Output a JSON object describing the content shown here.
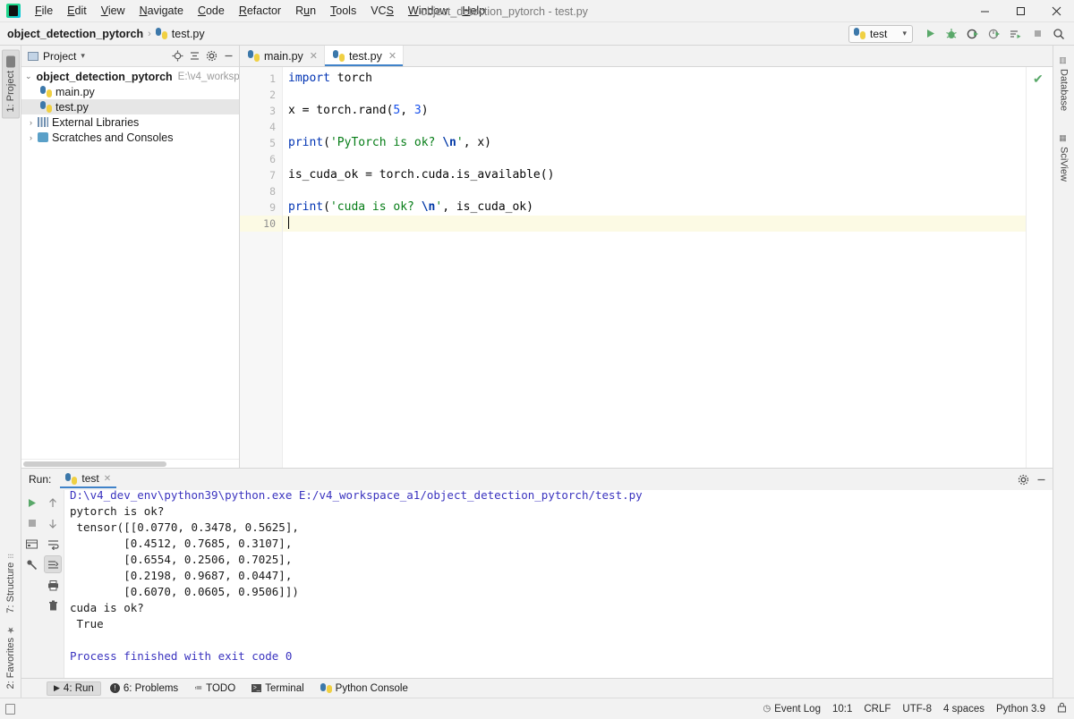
{
  "window": {
    "title": "object_detection_pytorch - test.py",
    "controls": {
      "minimize": "—",
      "maximize": "▢",
      "close": "✕"
    }
  },
  "menu": [
    {
      "label": "File"
    },
    {
      "label": "Edit"
    },
    {
      "label": "View"
    },
    {
      "label": "Navigate"
    },
    {
      "label": "Code"
    },
    {
      "label": "Refactor"
    },
    {
      "label": "Run"
    },
    {
      "label": "Tools"
    },
    {
      "label": "VCS"
    },
    {
      "label": "Window"
    },
    {
      "label": "Help"
    }
  ],
  "navbar": {
    "crumbs": [
      {
        "label": "object_detection_pytorch"
      },
      {
        "label": "test.py"
      }
    ],
    "separator": "›",
    "run_config": {
      "name": "test",
      "chevron": "▾"
    },
    "buttons": [
      {
        "name": "run-button",
        "title": "Run"
      },
      {
        "name": "debug-button",
        "title": "Debug"
      },
      {
        "name": "run-coverage-button",
        "title": "Run with Coverage"
      },
      {
        "name": "profile-button",
        "title": "Profile"
      },
      {
        "name": "run-tests-button",
        "title": "Run tests"
      },
      {
        "name": "stop-button",
        "title": "Stop"
      },
      {
        "name": "search-everywhere-button",
        "title": "Search Everywhere"
      }
    ]
  },
  "left_strip": {
    "top": [
      {
        "label": "1: Project",
        "active": true
      }
    ],
    "bottom": [
      {
        "label": "7: Structure",
        "active": false
      },
      {
        "label": "2: Favorites",
        "active": false
      }
    ]
  },
  "right_strip": [
    {
      "label": "Database"
    },
    {
      "label": "SciView"
    }
  ],
  "project_panel": {
    "title": "Project",
    "chevron": "▾",
    "header_icons": [
      "locate-icon",
      "collapse-all-icon",
      "settings-icon",
      "hide-icon"
    ],
    "tree": [
      {
        "indent": 0,
        "arrow": "⌄",
        "icon": "folder",
        "label": "object_detection_pytorch",
        "bold": true,
        "path": "E:\\v4_worksp",
        "selected": false
      },
      {
        "indent": 1,
        "arrow": "",
        "icon": "python",
        "label": "main.py",
        "bold": false,
        "path": "",
        "selected": false
      },
      {
        "indent": 1,
        "arrow": "",
        "icon": "python",
        "label": "test.py",
        "bold": false,
        "path": "",
        "selected": true
      },
      {
        "indent": 0,
        "arrow": "›",
        "icon": "library",
        "label": "External Libraries",
        "bold": false,
        "path": "",
        "selected": false
      },
      {
        "indent": 0,
        "arrow": "›",
        "icon": "scratch",
        "label": "Scratches and Consoles",
        "bold": false,
        "path": "",
        "selected": false
      }
    ]
  },
  "editor": {
    "tabs": [
      {
        "label": "main.py",
        "active": false,
        "close": "✕"
      },
      {
        "label": "test.py",
        "active": true,
        "close": "✕"
      }
    ],
    "line_numbers": [
      "1",
      "2",
      "3",
      "4",
      "5",
      "6",
      "7",
      "8",
      "9",
      "10"
    ],
    "current_line": 10,
    "inspection_status": "✔",
    "lines": [
      {
        "n": 1,
        "tokens": [
          {
            "t": "kw",
            "v": "import"
          },
          {
            "t": "txt",
            "v": " torch"
          }
        ]
      },
      {
        "n": 2,
        "tokens": []
      },
      {
        "n": 3,
        "tokens": [
          {
            "t": "txt",
            "v": "x = torch.rand("
          },
          {
            "t": "num",
            "v": "5"
          },
          {
            "t": "txt",
            "v": ", "
          },
          {
            "t": "num",
            "v": "3"
          },
          {
            "t": "txt",
            "v": ")"
          }
        ]
      },
      {
        "n": 4,
        "tokens": []
      },
      {
        "n": 5,
        "tokens": [
          {
            "t": "kw",
            "v": "print"
          },
          {
            "t": "txt",
            "v": "("
          },
          {
            "t": "str",
            "v": "'PyTorch is ok? "
          },
          {
            "t": "esc",
            "v": "\\n"
          },
          {
            "t": "str",
            "v": "'"
          },
          {
            "t": "txt",
            "v": ", x)"
          }
        ]
      },
      {
        "n": 6,
        "tokens": []
      },
      {
        "n": 7,
        "tokens": [
          {
            "t": "txt",
            "v": "is_cuda_ok = torch.cuda.is_available()"
          }
        ]
      },
      {
        "n": 8,
        "tokens": []
      },
      {
        "n": 9,
        "tokens": [
          {
            "t": "kw",
            "v": "print"
          },
          {
            "t": "txt",
            "v": "("
          },
          {
            "t": "str",
            "v": "'cuda is ok? "
          },
          {
            "t": "esc",
            "v": "\\n"
          },
          {
            "t": "str",
            "v": "'"
          },
          {
            "t": "txt",
            "v": ", is_cuda_ok)"
          }
        ]
      },
      {
        "n": 10,
        "tokens": []
      }
    ]
  },
  "run_panel": {
    "label": "Run:",
    "tab": {
      "label": "test",
      "close": "✕"
    },
    "header_icons": [
      "settings-icon",
      "hide-icon"
    ],
    "tools_left": [
      "rerun-icon",
      "stop-icon",
      "console-icon",
      "pin-icon"
    ],
    "tools_right": [
      "up-icon",
      "down-icon",
      "soft-wrap-icon",
      "scroll-to-end-icon",
      "print-icon",
      "trash-icon"
    ],
    "output": [
      {
        "cls": "cmd",
        "text": "D:\\v4_dev_env\\python39\\python.exe E:/v4_workspace_a1/object_detection_pytorch/test.py"
      },
      {
        "cls": "",
        "text": "pytorch is ok?"
      },
      {
        "cls": "",
        "text": " tensor([[0.0770, 0.3478, 0.5625],"
      },
      {
        "cls": "",
        "text": "        [0.4512, 0.7685, 0.3107],"
      },
      {
        "cls": "",
        "text": "        [0.6554, 0.2506, 0.7025],"
      },
      {
        "cls": "",
        "text": "        [0.2198, 0.9687, 0.0447],"
      },
      {
        "cls": "",
        "text": "        [0.6070, 0.0605, 0.9506]])"
      },
      {
        "cls": "",
        "text": "cuda is ok?"
      },
      {
        "cls": "",
        "text": " True"
      },
      {
        "cls": "",
        "text": ""
      },
      {
        "cls": "done",
        "text": "Process finished with exit code 0"
      }
    ]
  },
  "bottom_bar": [
    {
      "label": "4: Run",
      "icon": "run-icon",
      "active": true
    },
    {
      "label": "6: Problems",
      "icon": "problems-icon",
      "active": false
    },
    {
      "label": "TODO",
      "icon": "todo-icon",
      "active": false
    },
    {
      "label": "Terminal",
      "icon": "terminal-icon",
      "active": false
    },
    {
      "label": "Python Console",
      "icon": "python-console-icon",
      "active": false
    }
  ],
  "status_bar": {
    "event_log": "Event Log",
    "caret": "10:1",
    "line_sep": "CRLF",
    "encoding": "UTF-8",
    "indent": "4 spaces",
    "interpreter": "Python 3.9",
    "lock": "🔒"
  },
  "colors": {
    "accent": "#4083c9",
    "run_green": "#59a869",
    "keyword": "#0033b3",
    "string": "#067d17",
    "number": "#1750eb",
    "console_cmd": "#3a33bf"
  }
}
